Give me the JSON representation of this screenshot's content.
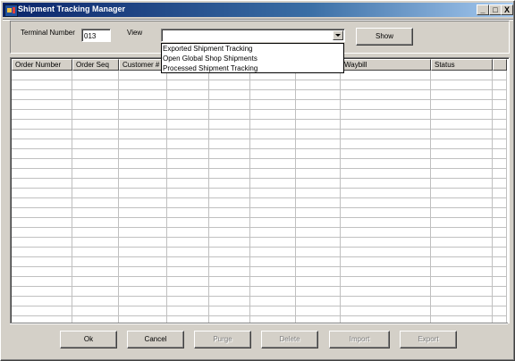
{
  "window": {
    "title": "Shipment Tracking Manager",
    "min_label": "_",
    "max_label": "□",
    "close_label": "X"
  },
  "form": {
    "terminal_label": "Terminal Number",
    "terminal_value": "013",
    "view_label": "View",
    "view_value": "",
    "show_label": "Show",
    "view_options": [
      "Exported Shipment Tracking",
      "Open Global Shop Shipments",
      "Processed Shipment Tracking"
    ]
  },
  "grid": {
    "columns": [
      "Order Number",
      "Order Seq",
      "Customer #",
      "",
      "",
      "",
      "",
      "Waybill",
      "Status",
      ""
    ]
  },
  "buttons": {
    "ok": "Ok",
    "cancel": "Cancel",
    "purge": "Purge",
    "delete": "Delete",
    "import": "Import",
    "export": "Export"
  }
}
